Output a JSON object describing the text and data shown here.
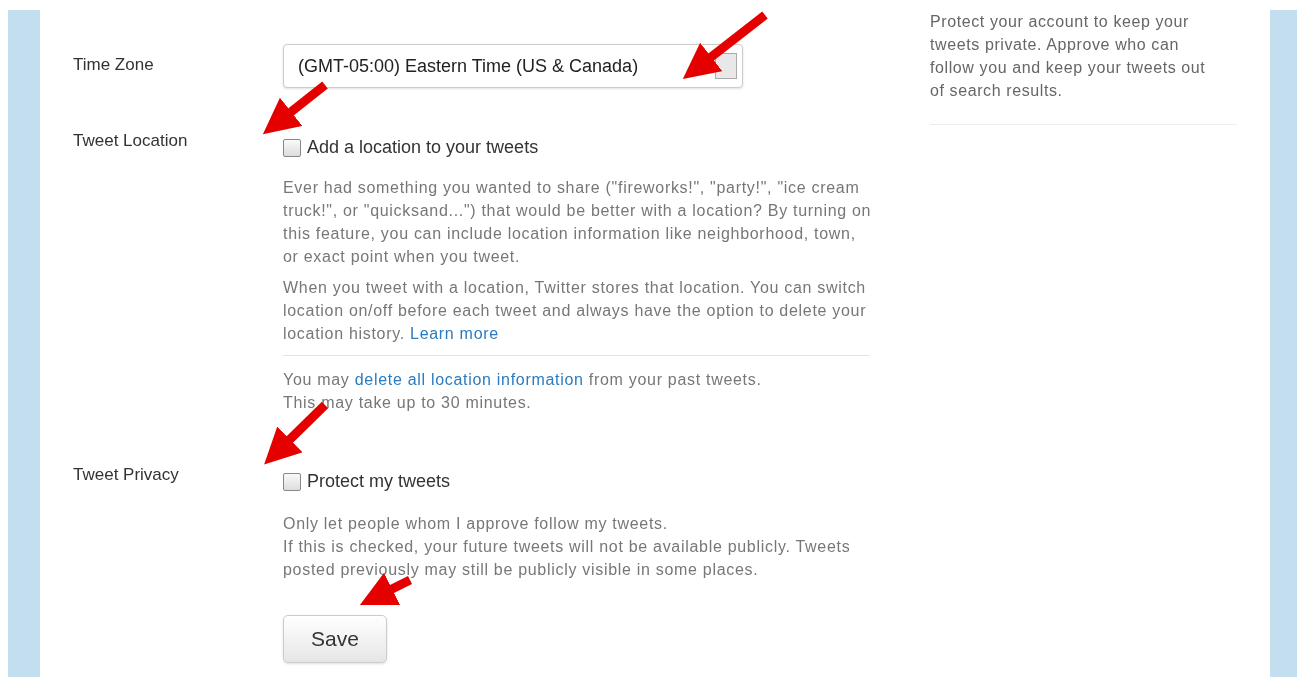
{
  "settings": [
    {
      "kind": "select",
      "label": "Time Zone",
      "value": "(GMT-05:00) Eastern Time (US & Canada)"
    },
    {
      "kind": "checkbox",
      "label": "Tweet Location",
      "option": "Add a location to your tweets",
      "checked": false,
      "paragraphs": [
        {
          "text": "Ever had something you wanted to share (\"fireworks!\", \"party!\", \"ice cream truck!\", or \"quicksand...\") that would be better with a location? By turning on this feature, you can include location information like neighborhood, town, or exact point when you tweet."
        },
        {
          "text": "When you tweet with a location, Twitter stores that location. You can switch location on/off before each tweet and always have the option to delete your location history.",
          "link": "Learn more"
        }
      ],
      "extra": {
        "before": "You may",
        "link": "delete all location information",
        "after": "from your past tweets.",
        "note": "This may take up to 30 minutes."
      }
    },
    {
      "kind": "checkbox",
      "label": "Tweet Privacy",
      "option": "Protect my tweets",
      "checked": false,
      "lines": [
        "Only let people whom I approve follow my tweets.",
        "If this is checked, your future tweets will not be available publicly. Tweets posted previously may still be publicly visible in some places."
      ]
    }
  ],
  "save_button": "Save",
  "sidebar_note": "Protect your account to keep your tweets private. Approve who can follow you and keep your tweets out of search results."
}
